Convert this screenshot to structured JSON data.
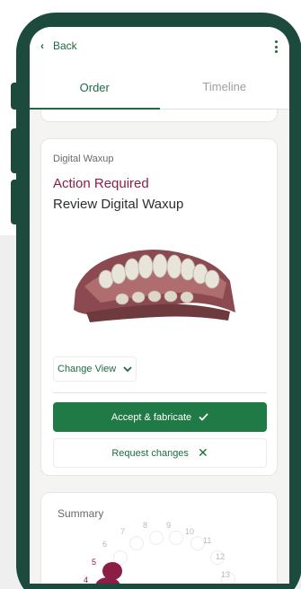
{
  "header": {
    "back_label": "Back"
  },
  "tabs": [
    {
      "label": "Order",
      "active": true
    },
    {
      "label": "Timeline",
      "active": false
    }
  ],
  "card": {
    "label": "Digital Waxup",
    "status": "Action Required",
    "title": "Review Digital Waxup",
    "change_view_label": "Change View",
    "accept_label": "Accept & fabricate",
    "request_label": "Request changes"
  },
  "summary": {
    "title": "Summary",
    "teeth": [
      {
        "num": "4",
        "selected": true
      },
      {
        "num": "5",
        "selected": true
      },
      {
        "num": "6",
        "selected": false
      },
      {
        "num": "7",
        "selected": false
      },
      {
        "num": "8",
        "selected": false
      },
      {
        "num": "9",
        "selected": false
      },
      {
        "num": "10",
        "selected": false
      },
      {
        "num": "11",
        "selected": false
      },
      {
        "num": "12",
        "selected": false
      },
      {
        "num": "13",
        "selected": false
      }
    ]
  },
  "colors": {
    "brand_dark": "#1c4a3c",
    "accent_green": "#1f7a45",
    "status_maroon": "#8b1d47"
  }
}
